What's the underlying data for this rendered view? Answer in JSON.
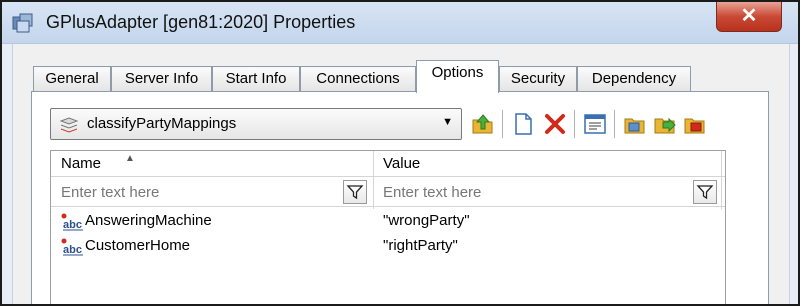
{
  "window": {
    "title": "GPlusAdapter [gen81:2020] Properties",
    "close_label": "✕"
  },
  "tabs": [
    {
      "label": "General"
    },
    {
      "label": "Server Info"
    },
    {
      "label": "Start Info"
    },
    {
      "label": "Connections"
    },
    {
      "label": "Options",
      "active": true
    },
    {
      "label": "Security"
    },
    {
      "label": "Dependency"
    }
  ],
  "section_select": {
    "value": "classifyPartyMappings",
    "arrow": "▼"
  },
  "toolbar": {
    "icons": [
      "up-folder-icon",
      "new-document-icon",
      "delete-icon",
      "edit-icon",
      "import-icon",
      "export-icon",
      "copy-icon"
    ]
  },
  "grid": {
    "columns": [
      {
        "label": "Name",
        "filter_placeholder": "Enter text here",
        "sort": "▲"
      },
      {
        "label": "Value",
        "filter_placeholder": "Enter text here"
      }
    ],
    "rows": [
      {
        "name": "AnsweringMachine",
        "value": "\"wrongParty\""
      },
      {
        "name": "CustomerHome",
        "value": "\"rightParty\""
      }
    ]
  },
  "colors": {
    "accent_red": "#d12a1a",
    "folder_yellow": "#e8b634",
    "tab_border": "#8e9bab"
  }
}
